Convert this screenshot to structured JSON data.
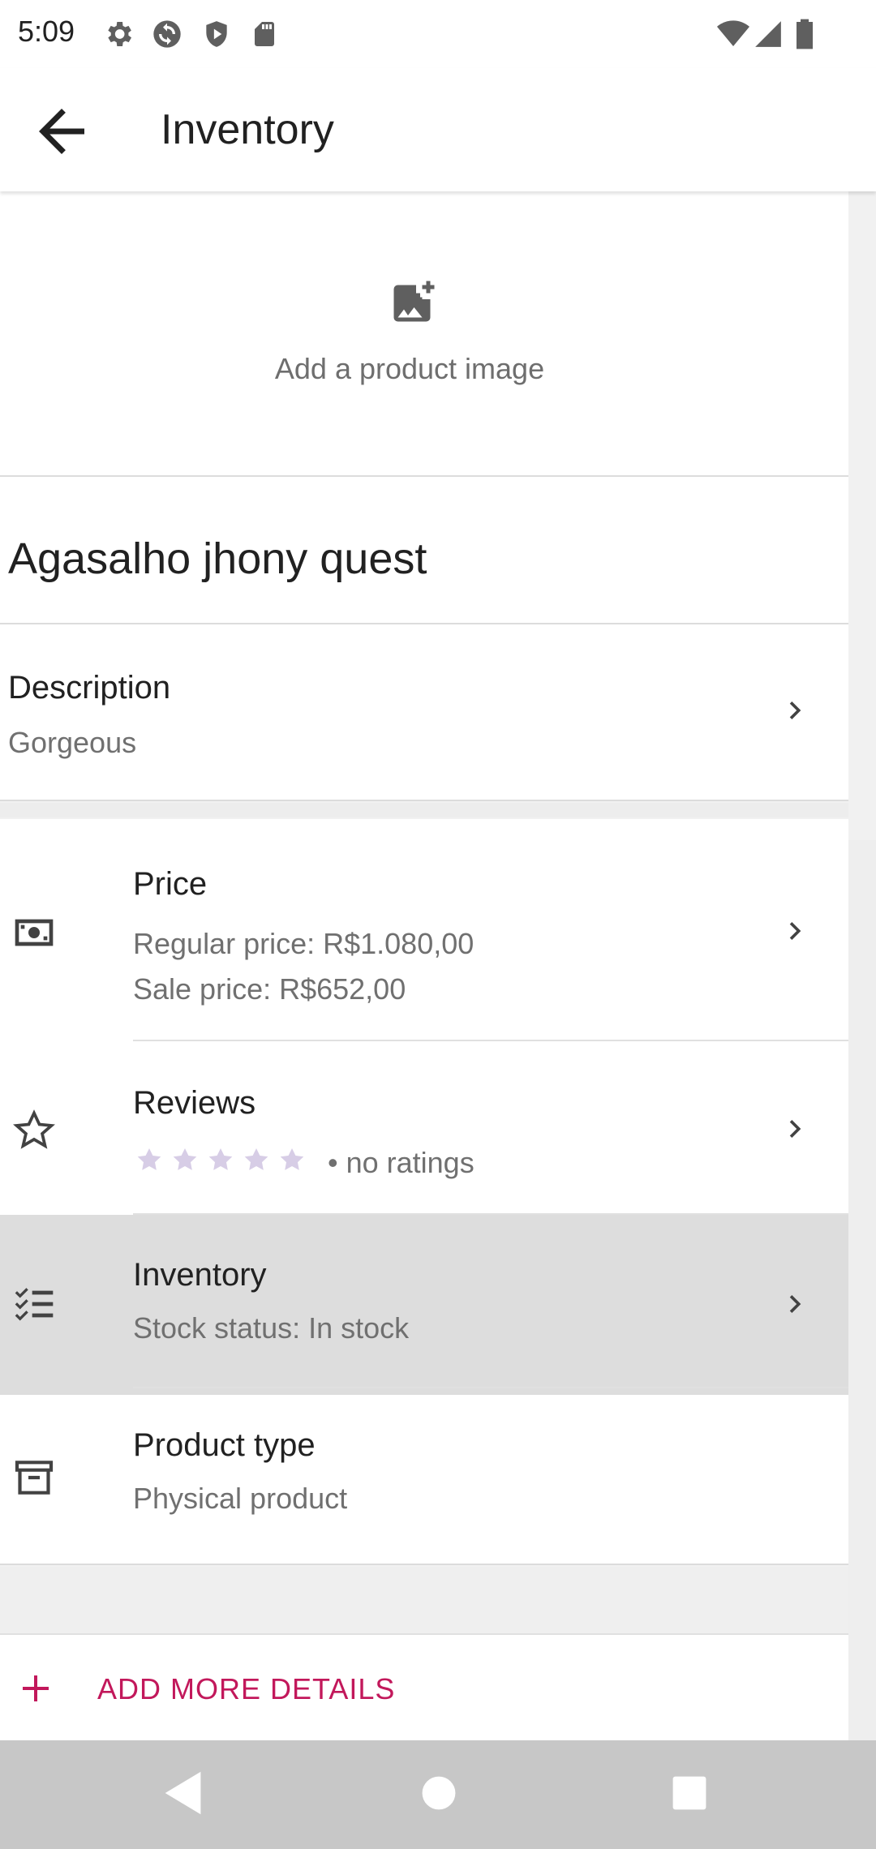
{
  "status_bar": {
    "time": "5:09",
    "left_icons": [
      "settings-icon",
      "sync-icon",
      "shield-icon",
      "sd-card-icon"
    ],
    "right_icons": [
      "wifi-icon",
      "cell-signal-icon",
      "battery-icon"
    ]
  },
  "app_bar": {
    "title": "Inventory",
    "back_icon": "arrow-back-icon"
  },
  "image_section": {
    "label": "Add a product image",
    "icon": "add-photo-icon"
  },
  "product": {
    "title": "Agasalho jhony quest"
  },
  "description": {
    "title": "Description",
    "value": "Gorgeous"
  },
  "details": [
    {
      "title": "Price",
      "lines": [
        "Regular price: R$1.080,00",
        "Sale price: R$652,00"
      ],
      "icon": "money-icon"
    },
    {
      "title": "Reviews",
      "rating": 0,
      "rating_max": 5,
      "rating_text": "• no ratings",
      "icon": "star-outline-icon"
    },
    {
      "title": "Inventory",
      "lines": [
        "Stock status: In stock"
      ],
      "icon": "checklist-icon",
      "highlighted": true
    },
    {
      "title": "Product type",
      "lines": [
        "Physical product"
      ],
      "icon": "archive-box-icon"
    }
  ],
  "add_more": {
    "label": "ADD MORE DETAILS",
    "icon": "plus-icon",
    "color": "#c2185b"
  },
  "nav_bar": {
    "buttons": [
      "nav-back-icon",
      "nav-home-icon",
      "nav-recents-icon"
    ]
  },
  "colors": {
    "accent": "#c2185b",
    "star_empty": "#d7cde6",
    "highlight_row": "#dddddd"
  }
}
